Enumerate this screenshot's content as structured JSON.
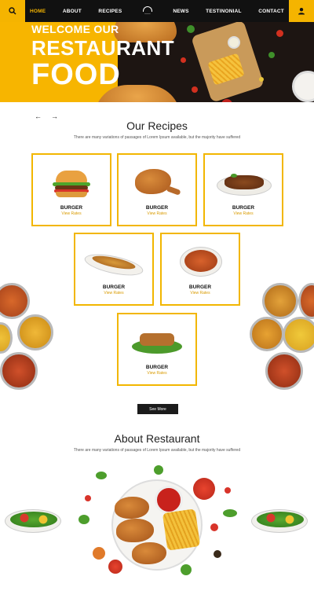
{
  "nav": {
    "items": [
      "HOME",
      "ABOUT",
      "RECIPES",
      "NEWS",
      "TESTINONIAL",
      "CONTACT"
    ],
    "active_index": 0
  },
  "hero": {
    "line1": "WELCOME OUR",
    "line2": "RESTAURANT",
    "line3": "FOOD"
  },
  "recipes": {
    "title": "Our Recipes",
    "subtitle": "There are many variations of passages of Lorem Ipsum available, but the majority have suffered",
    "cards": [
      {
        "name": "BURGER",
        "link": "View Rates",
        "image": "burger"
      },
      {
        "name": "BURGER",
        "link": "View Rates",
        "image": "fried-chicken"
      },
      {
        "name": "BURGER",
        "link": "View Rates",
        "image": "grilled-dish"
      },
      {
        "name": "BURGER",
        "link": "View Rates",
        "image": "long-plate"
      },
      {
        "name": "BURGER",
        "link": "View Rates",
        "image": "chicken-plate"
      },
      {
        "name": "BURGER",
        "link": "View Rates",
        "image": "sandwich"
      }
    ],
    "see_more": "See More"
  },
  "about": {
    "title": "About Restaurant",
    "subtitle": "There are many variations of passages of Lorem Ipsum available, but the majority have suffered"
  },
  "icons": {
    "search": "search-icon",
    "user": "user-icon",
    "prev": "arrow-left-icon",
    "next": "arrow-right-icon"
  },
  "colors": {
    "accent": "#f5b400",
    "dark": "#111111"
  }
}
